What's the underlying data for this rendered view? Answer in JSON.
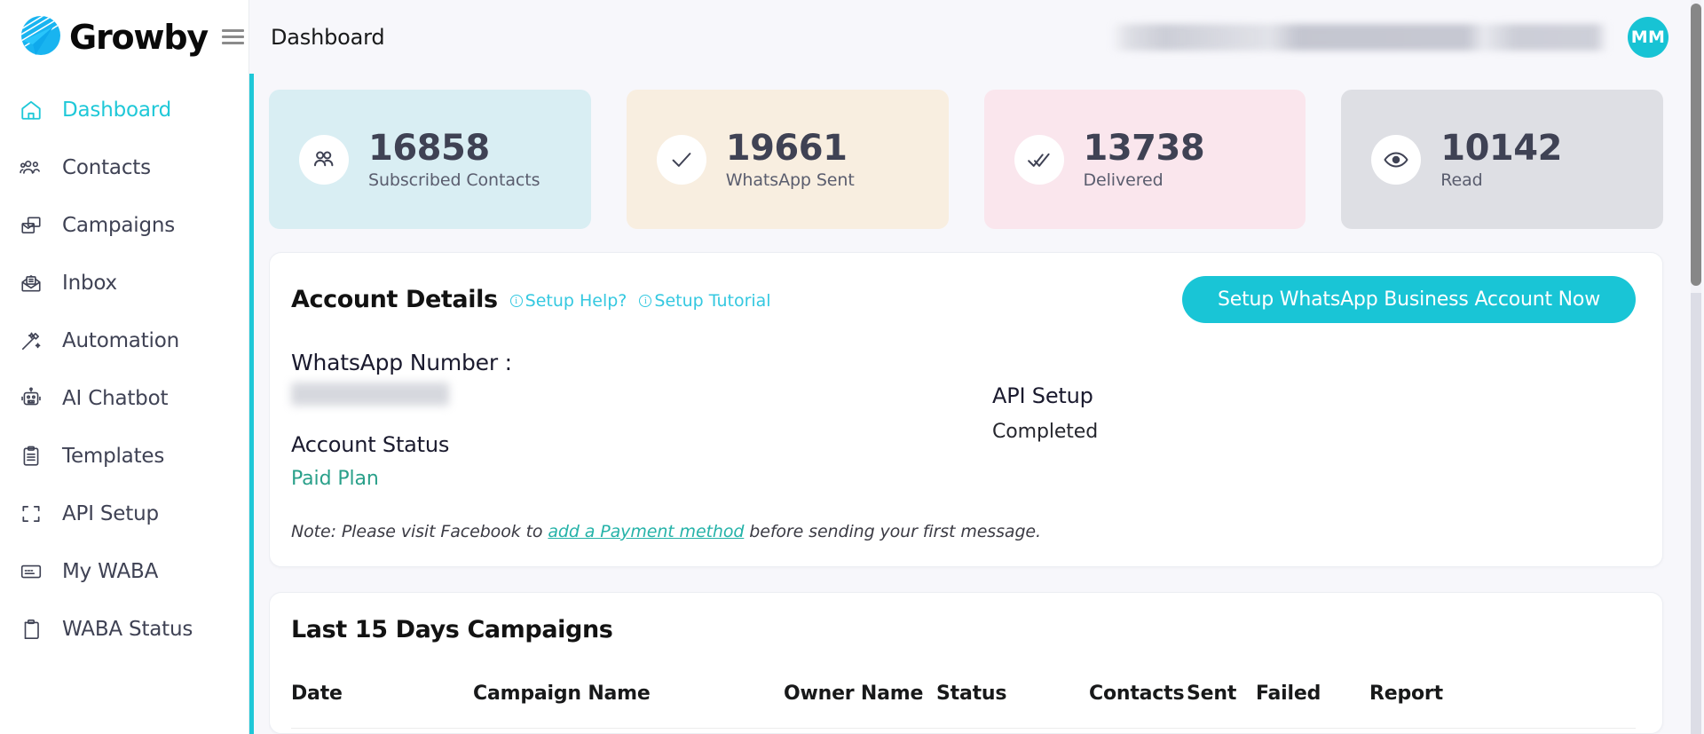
{
  "brand": {
    "name": "Growby",
    "menu_icon": "hamburger-icon"
  },
  "sidebar": {
    "items": [
      {
        "label": "Dashboard",
        "icon": "home-icon",
        "active": true
      },
      {
        "label": "Contacts",
        "icon": "users-icon",
        "active": false
      },
      {
        "label": "Campaigns",
        "icon": "campaign-icon",
        "active": false
      },
      {
        "label": "Inbox",
        "icon": "inbox-icon",
        "active": false
      },
      {
        "label": "Automation",
        "icon": "magic-wand-icon",
        "active": false
      },
      {
        "label": "AI Chatbot",
        "icon": "robot-icon",
        "active": false
      },
      {
        "label": "Templates",
        "icon": "clipboard-icon",
        "active": false
      },
      {
        "label": "API Setup",
        "icon": "brackets-icon",
        "active": false
      },
      {
        "label": "My WABA",
        "icon": "card-icon",
        "active": false
      },
      {
        "label": "WABA Status",
        "icon": "clipboard-status-icon",
        "active": false
      }
    ]
  },
  "topbar": {
    "breadcrumb": "Dashboard",
    "account_info_redacted": "",
    "avatar_initials": "MM"
  },
  "stats": [
    {
      "value": "16858",
      "label": "Subscribed Contacts",
      "icon": "users-icon",
      "bg": "#d9eef3"
    },
    {
      "value": "19661",
      "label": "WhatsApp Sent",
      "icon": "check-icon",
      "bg": "#f8eee0"
    },
    {
      "value": "13738",
      "label": "Delivered",
      "icon": "double-check-icon",
      "bg": "#fae6ed"
    },
    {
      "value": "10142",
      "label": "Read",
      "icon": "eye-icon",
      "bg": "#dedfe4"
    }
  ],
  "account_details": {
    "title": "Account Details",
    "setup_help_label": "Setup Help?",
    "setup_tutorial_label": "Setup Tutorial",
    "cta_label": "Setup WhatsApp Business Account Now",
    "whatsapp_number_label": "WhatsApp Number :",
    "whatsapp_number_value": "",
    "account_status_label": "Account Status",
    "account_status_value": "Paid Plan",
    "api_setup_label": "API Setup",
    "api_setup_value": "Completed",
    "note_prefix": "Note: Please visit Facebook to ",
    "note_link": "add a Payment method",
    "note_suffix": " before sending your first message."
  },
  "campaigns": {
    "title": "Last 15 Days Campaigns",
    "columns": [
      "Date",
      "Campaign Name",
      "Owner Name",
      "Status",
      "Contacts",
      "Sent",
      "Failed",
      "Report"
    ],
    "rows": []
  },
  "colors": {
    "accent": "#1fc8d8",
    "cta": "#19c5d6",
    "link": "#34c8e0",
    "status_green": "#2aa08a",
    "text_dark": "#3f4254",
    "page_bg": "#f7f7fb"
  }
}
